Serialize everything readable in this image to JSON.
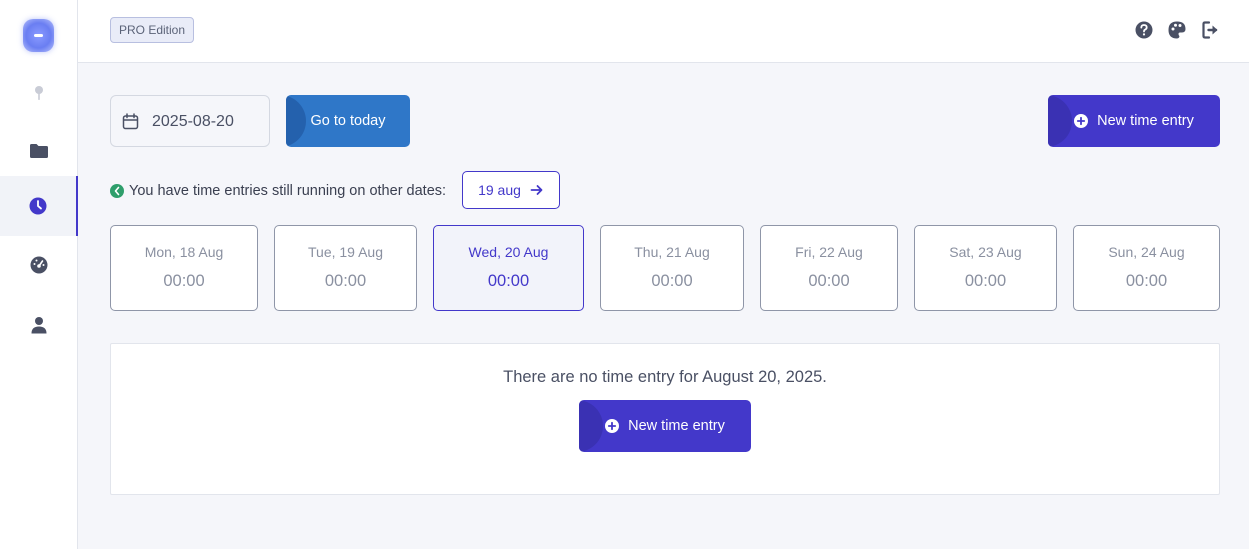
{
  "sidebar": {
    "logo": "app-logo",
    "items": [
      {
        "icon": "pin-icon",
        "active": false
      },
      {
        "icon": "folder-icon",
        "active": false
      },
      {
        "icon": "clock-icon",
        "active": true
      },
      {
        "icon": "dashboard-gauge-icon",
        "active": false
      },
      {
        "icon": "user-icon",
        "active": false
      }
    ]
  },
  "topbar": {
    "badge": "PRO Edition",
    "icons": [
      "help-icon",
      "palette-icon",
      "logout-icon"
    ]
  },
  "toolbar": {
    "date_value": "2025-08-20",
    "today_label": "Go to today",
    "new_entry_label": "New time entry"
  },
  "running": {
    "message": "You have time entries still running on other dates:",
    "date_label": "19 aug"
  },
  "week": [
    {
      "label": "Mon, 18 Aug",
      "total": "00:00",
      "active": false
    },
    {
      "label": "Tue, 19 Aug",
      "total": "00:00",
      "active": false
    },
    {
      "label": "Wed, 20 Aug",
      "total": "00:00",
      "active": true
    },
    {
      "label": "Thu, 21 Aug",
      "total": "00:00",
      "active": false
    },
    {
      "label": "Fri, 22 Aug",
      "total": "00:00",
      "active": false
    },
    {
      "label": "Sat, 23 Aug",
      "total": "00:00",
      "active": false
    },
    {
      "label": "Sun, 24 Aug",
      "total": "00:00",
      "active": false
    }
  ],
  "empty_state": {
    "message": "There are no time entry for August 20, 2025.",
    "button_label": "New time entry"
  },
  "colors": {
    "accent": "#4338ca",
    "today_button": "#2f77c8",
    "running_indicator": "#2e9e6b"
  }
}
